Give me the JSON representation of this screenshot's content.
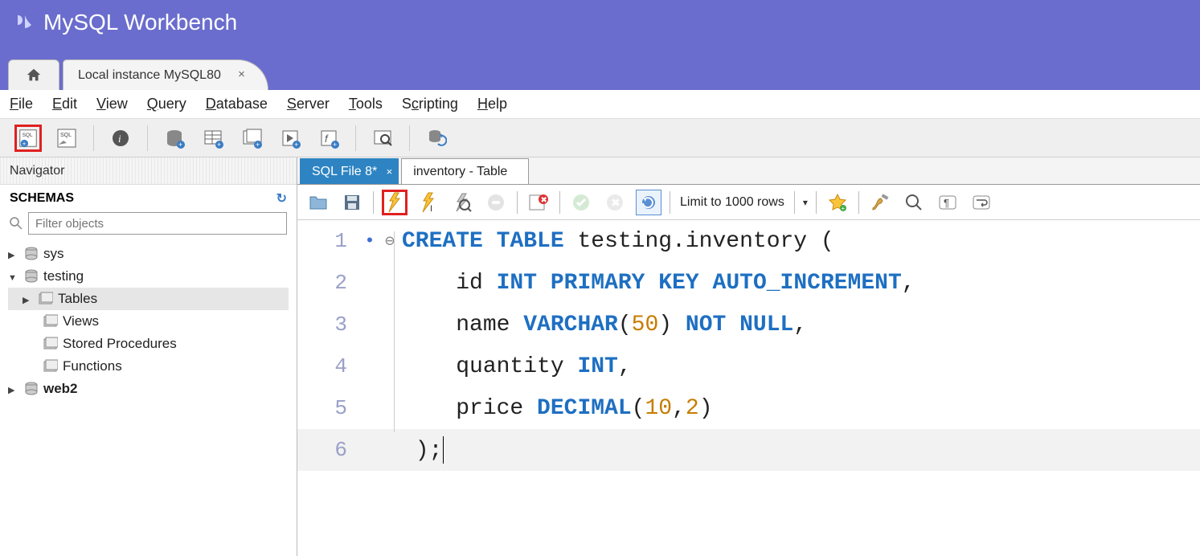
{
  "app": {
    "title": "MySQL Workbench"
  },
  "connection_tab": {
    "label": "Local instance MySQL80"
  },
  "menu": {
    "file": "File",
    "edit": "Edit",
    "view": "View",
    "query": "Query",
    "database": "Database",
    "server": "Server",
    "tools": "Tools",
    "scripting": "Scripting",
    "help": "Help"
  },
  "navigator": {
    "title": "Navigator",
    "schemas_label": "SCHEMAS",
    "filter_placeholder": "Filter objects",
    "tree": {
      "sys": "sys",
      "testing": "testing",
      "tables": "Tables",
      "views": "Views",
      "stored_procedures": "Stored Procedures",
      "functions": "Functions",
      "web2": "web2"
    }
  },
  "editor_tabs": {
    "active": "SQL File 8*",
    "inactive": "inventory - Table"
  },
  "editor_toolbar": {
    "limit": "Limit to 1000 rows"
  },
  "code": {
    "l1a": "CREATE",
    "l1b": "TABLE",
    "l1c": " testing.inventory (",
    "l2a": "    id ",
    "l2b": "INT",
    "l2c": " ",
    "l2d": "PRIMARY",
    "l2e": " ",
    "l2f": "KEY",
    "l2g": " ",
    "l2h": "AUTO_INCREMENT",
    "l2i": ",",
    "l3a": "    name ",
    "l3b": "VARCHAR",
    "l3c": "(",
    "l3d": "50",
    "l3e": ") ",
    "l3f": "NOT",
    "l3g": " ",
    "l3h": "NULL",
    "l3i": ",",
    "l4a": "    quantity ",
    "l4b": "INT",
    "l4c": ",",
    "l5a": "    price ",
    "l5b": "DECIMAL",
    "l5c": "(",
    "l5d": "10",
    "l5e": ",",
    "l5f": "2",
    "l5g": ")",
    "l6a": " );",
    "n1": "1",
    "n2": "2",
    "n3": "3",
    "n4": "4",
    "n5": "5",
    "n6": "6"
  }
}
